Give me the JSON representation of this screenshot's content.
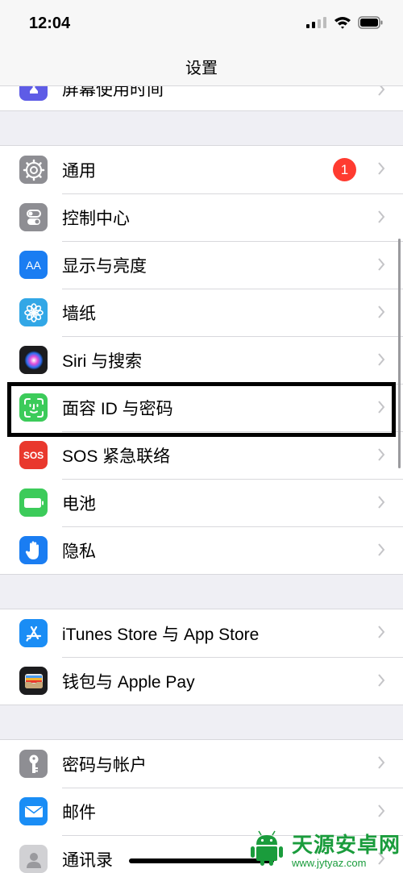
{
  "status": {
    "time": "12:04"
  },
  "nav": {
    "title": "设置"
  },
  "top_partial": {
    "label": "屏幕使用时间"
  },
  "groups": [
    [
      {
        "label": "通用",
        "icon": "gear-icon",
        "color": "#8e8e93",
        "badge": "1"
      },
      {
        "label": "控制中心",
        "icon": "toggles-icon",
        "color": "#8e8e93"
      },
      {
        "label": "显示与亮度",
        "icon": "text-size-icon",
        "color": "#1a7df2"
      },
      {
        "label": "墙纸",
        "icon": "flower-icon",
        "color": "#32a7e6"
      },
      {
        "label": "Siri 与搜索",
        "icon": "siri-icon",
        "color": "#1c1c1e"
      },
      {
        "label": "面容 ID 与密码",
        "icon": "face-id-icon",
        "color": "#3ccb5a"
      },
      {
        "label": "SOS 紧急联络",
        "icon": "sos-icon",
        "color": "#e9382d"
      },
      {
        "label": "电池",
        "icon": "battery-icon",
        "color": "#3ccb5a"
      },
      {
        "label": "隐私",
        "icon": "hand-icon",
        "color": "#1a7df2"
      }
    ],
    [
      {
        "label": "iTunes Store 与 App Store",
        "icon": "app-store-icon",
        "color": "#1a8df5"
      },
      {
        "label": "钱包与 Apple Pay",
        "icon": "wallet-icon",
        "color": "#1c1c1e"
      }
    ],
    [
      {
        "label": "密码与帐户",
        "icon": "key-icon",
        "color": "#8e8e93"
      },
      {
        "label": "邮件",
        "icon": "mail-icon",
        "color": "#1a8df5"
      },
      {
        "label": "通讯录",
        "icon": "contacts-icon",
        "color": "#c9c9cc"
      }
    ]
  ],
  "watermark": {
    "title": "天源安卓网",
    "url": "www.jytyaz.com",
    "color": "#1a9c3c"
  },
  "sos_text": "SOS",
  "display_icon_text": "AA"
}
